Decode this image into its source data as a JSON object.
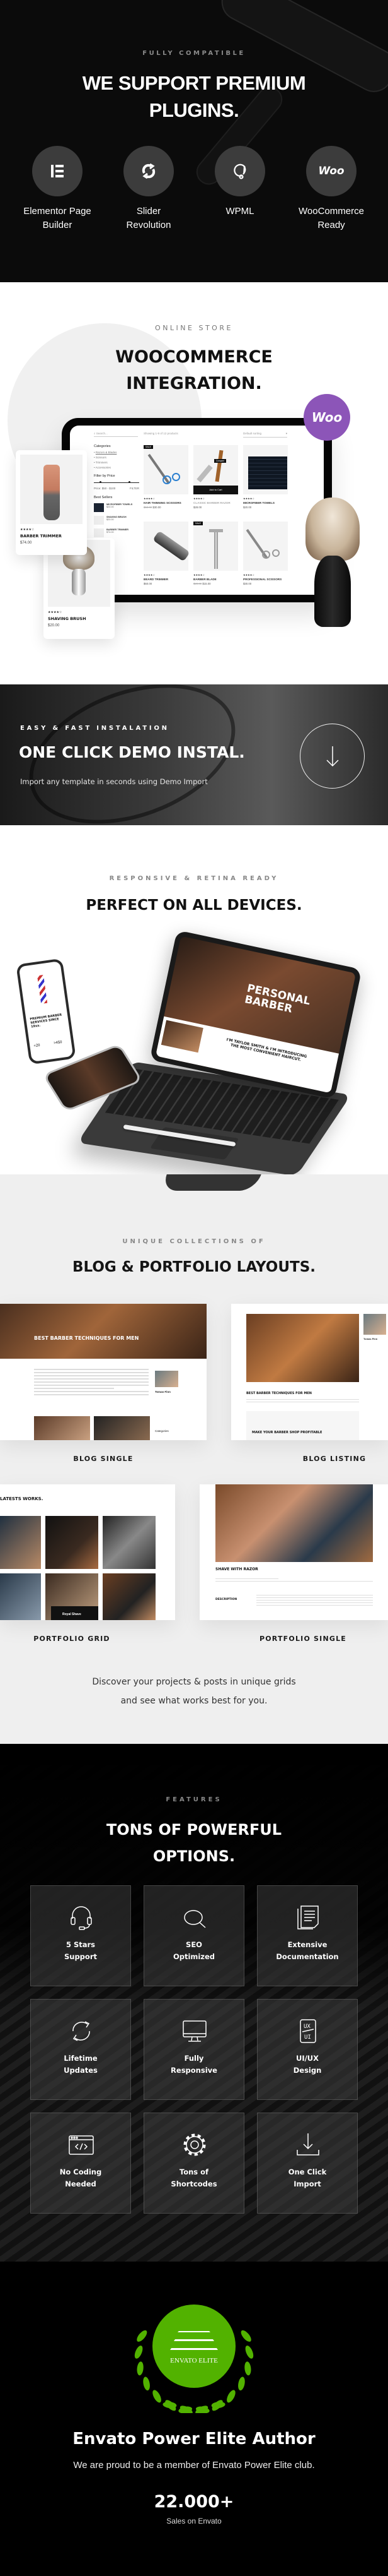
{
  "plugins": {
    "eyebrow": "FULLY COMPATIBLE",
    "title_line1": "WE SUPPORT PREMIUM",
    "title_line2": "PLUGINS.",
    "circle_color": "#3c3c3c",
    "items": [
      {
        "icon": "elementor-icon",
        "line1": "Elementor Page",
        "line2": "Builder"
      },
      {
        "icon": "slider-revolution-icon",
        "line1": "Slider",
        "line2": "Revolution"
      },
      {
        "icon": "wpml-icon",
        "line1": "WPML",
        "line2": ""
      },
      {
        "icon": "woocommerce-icon",
        "logo_text": "Woo",
        "line1": "WooCommerce",
        "line2": "Ready"
      }
    ]
  },
  "store": {
    "eyebrow": "ONLINE STORE",
    "title_line1": "WOOCOMMERCE",
    "title_line2": "INTEGRATION.",
    "badge_text": "Woo",
    "badge_color": "#8c55b8",
    "search_placeholder": "Search...",
    "result_count": "Showing 1-9 of 12 products",
    "sorting": "Default sorting",
    "categories_title": "Categories",
    "categories": [
      "Razors & Blades",
      "Scissors",
      "Trimmers",
      "Accessories"
    ],
    "filter_title": "Filter by Price",
    "price_range": "Price: $50 - $100",
    "filter_button": "FILTER",
    "best_sellers_title": "Best Sellers",
    "best_sellers": [
      {
        "name": "MICROFIBER TOWELS",
        "price": "$20.00"
      },
      {
        "name": "SHAVING BRUSH",
        "price": "$20.00"
      },
      {
        "name": "BARBER TRIMMER",
        "price": "$74.00"
      }
    ],
    "sale_label": "SALE",
    "add_to_cart": "Add to Cart",
    "compare": "Compare",
    "products": [
      {
        "name": "HAIR THINNING SCISSORS",
        "old_price": "$50.00",
        "price": "$30.00",
        "stars": "★★★★☆"
      },
      {
        "name": "CLASSIC BARBER RAZOR",
        "old_price": "",
        "price": "$28.00",
        "stars": "★★★★☆"
      },
      {
        "name": "MICROFIBER TOWELS",
        "old_price": "",
        "price": "$20.00",
        "stars": "★★★★☆"
      },
      {
        "name": "BEARD TRIMMER",
        "old_price": "",
        "price": "$60.00",
        "stars": "★★★★☆"
      },
      {
        "name": "BARBER BLADE",
        "old_price": "$20.00",
        "price": "$15.00",
        "stars": "★★★★☆"
      },
      {
        "name": "PROFESSIONAL SCISSORS",
        "old_price": "",
        "price": "$30.00",
        "stars": "★★★★☆"
      }
    ],
    "card_trimmer": {
      "stars": "★★★★☆",
      "name": "BARBER TRIMMER",
      "price": "$74.00"
    },
    "card_brush": {
      "stars": "★★★★☆",
      "name": "SHAVING BRUSH",
      "price": "$20.00"
    }
  },
  "demo": {
    "eyebrow": "EASY & FAST INSTALATION",
    "title": "ONE CLICK DEMO INSTAL.",
    "subtitle": "Import any template in seconds using Demo Import",
    "button_icon": "arrow-down-icon"
  },
  "devices": {
    "eyebrow": "RESPONSIVE & RETINA READY",
    "title": "PERFECT ON ALL DEVICES.",
    "tablet_hero": "PERSONAL BARBER",
    "tablet_intro": "I'M TAYLOR SMITH & I'M INTRODUCING THE MOST CONVENIENT HAIRCUT.",
    "phone_heading": "PREMIUM BARBER SERVICES SINCE 19xx.",
    "phone_stat1": "+20",
    "phone_stat2": ">450"
  },
  "layouts": {
    "eyebrow": "UNIQUE COLLECTIONS OF",
    "title": "BLOG & PORTFOLIO LAYOUTS.",
    "blog_single": {
      "label": "BLOG SINGLE",
      "post_title": "BEST BARBER TECHNIQUES FOR MEN",
      "author": "Tomas Finn",
      "categories": "Categories"
    },
    "blog_listing": {
      "label": "BLOG LISTING",
      "post1": "BEST BARBER TECHNIQUES FOR MEN",
      "post2": "MAKE YOUR BARBER SHOP PROFITABLE",
      "author": "Tomas Finn"
    },
    "portfolio_grid": {
      "label": "PORTFOLIO GRID",
      "heading": "LATESTS WORKS.",
      "item_caption": "Royal Shave"
    },
    "portfolio_single": {
      "label": "PORTFOLIO SINGLE",
      "title": "SHAVE WITH RAZOR",
      "section": "DESCRIPTION"
    },
    "description_line1": "Discover your projects & posts in unique grids",
    "description_line2": "and see what works best for you."
  },
  "features": {
    "eyebrow": "FEATURES",
    "title_line1": "TONS OF POWERFUL",
    "title_line2": "OPTIONS.",
    "ux_text": "UX",
    "ui_text": "UI",
    "items": [
      {
        "icon": "headset-icon",
        "line1": "5 Stars",
        "line2": "Support"
      },
      {
        "icon": "search-icon",
        "line1": "SEO",
        "line2": "Optimized"
      },
      {
        "icon": "documents-icon",
        "line1": "Extensive",
        "line2": "Documentation"
      },
      {
        "icon": "refresh-icon",
        "line1": "Lifetime",
        "line2": "Updates"
      },
      {
        "icon": "monitor-icon",
        "line1": "Fully",
        "line2": "Responsive"
      },
      {
        "icon": "ui-ux-icon",
        "line1": "UI/UX",
        "line2": "Design"
      },
      {
        "icon": "code-window-icon",
        "line1": "No Coding",
        "line2": "Needed"
      },
      {
        "icon": "gear-icon",
        "line1": "Tons of",
        "line2": "Shortcodes"
      },
      {
        "icon": "download-icon",
        "line1": "One Click",
        "line2": "Import"
      }
    ]
  },
  "author": {
    "badge_text": "ENVATO ELITE",
    "badge_color": "#52b200",
    "title": "Envato Power Elite Author",
    "subtitle": "We are proud to be a member of Envato Power Elite club.",
    "sales_count": "22.000+",
    "sales_label": "Sales on Envato"
  }
}
